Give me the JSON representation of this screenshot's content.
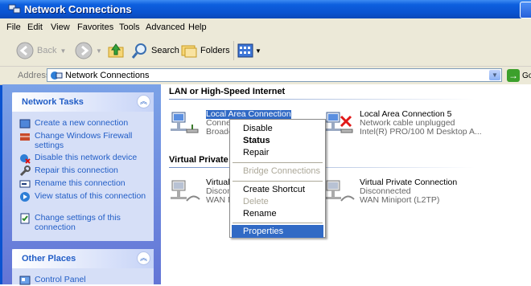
{
  "window": {
    "title": "Network Connections"
  },
  "menubar": [
    "File",
    "Edit",
    "View",
    "Favorites",
    "Tools",
    "Advanced",
    "Help"
  ],
  "toolbar": {
    "back": "Back",
    "search": "Search",
    "folders": "Folders"
  },
  "address": {
    "label": "Address",
    "value": "Network Connections",
    "go": "Go"
  },
  "tasks": {
    "title": "Network Tasks",
    "items": [
      "Create a new connection",
      "Change Windows Firewall settings",
      "Disable this network device",
      "Repair this connection",
      "Rename this connection",
      "View status of this connection",
      "Change settings of this connection"
    ]
  },
  "other_places": {
    "title": "Other Places",
    "items": [
      "Control Panel"
    ]
  },
  "groups": {
    "lan": "LAN or High-Speed Internet",
    "vpn": "Virtual Private N"
  },
  "connections": {
    "lan1": {
      "name": "Local Area Connection",
      "line2": "Conne",
      "line3": "Broadc"
    },
    "lan5": {
      "name": "Local Area Connection 5",
      "status": "Network cable unplugged",
      "device": "Intel(R) PRO/100 M Desktop A..."
    },
    "vpn1": {
      "name": "Virtual",
      "status": "Discon",
      "device": "WAN M"
    },
    "vpn2": {
      "name": "Virtual Private Connection",
      "status": "Disconnected",
      "device": "WAN Miniport (L2TP)"
    }
  },
  "context_menu": {
    "items": [
      "Disable",
      "Status",
      "Repair",
      "Bridge Connections",
      "Create Shortcut",
      "Delete",
      "Rename",
      "Properties"
    ]
  }
}
